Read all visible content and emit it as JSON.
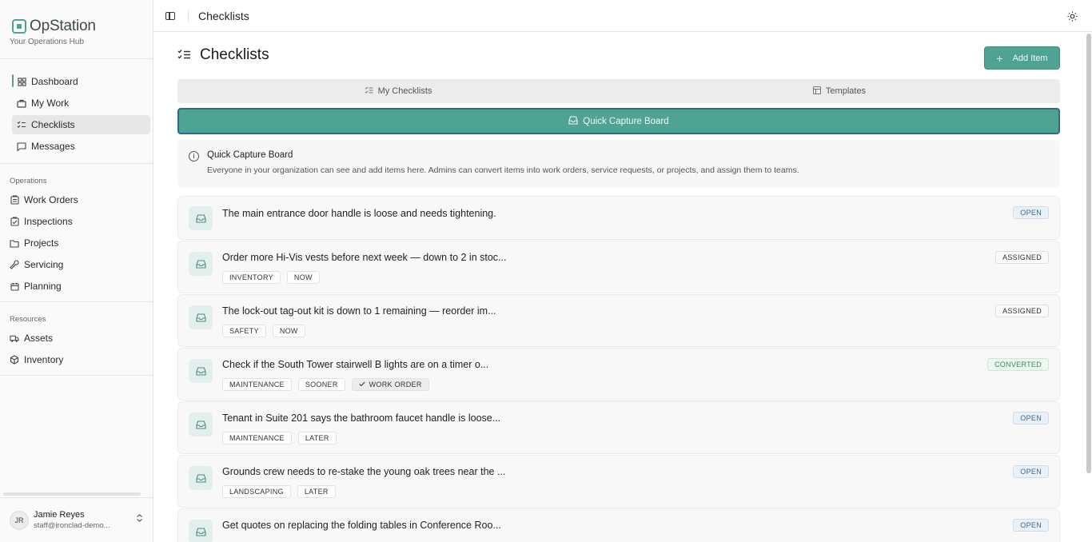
{
  "brand": {
    "name": "OpStation",
    "tagline": "Your Operations Hub"
  },
  "nav_top": [
    {
      "label": "Dashboard",
      "icon": "dashboard-icon"
    },
    {
      "label": "My Work",
      "icon": "briefcase-icon"
    },
    {
      "label": "Checklists",
      "icon": "checklist-icon"
    },
    {
      "label": "Messages",
      "icon": "message-icon"
    }
  ],
  "operations": {
    "label": "Operations",
    "items": [
      {
        "label": "Work Orders"
      },
      {
        "label": "Inspections"
      },
      {
        "label": "Projects"
      },
      {
        "label": "Servicing"
      },
      {
        "label": "Planning"
      }
    ]
  },
  "resources": {
    "label": "Resources",
    "items": [
      {
        "label": "Assets"
      },
      {
        "label": "Inventory"
      }
    ]
  },
  "user": {
    "initials": "JR",
    "name": "Jamie Reyes",
    "email": "staff@ironclad-demo..."
  },
  "topbar": {
    "title": "Checklists"
  },
  "page": {
    "title": "Checklists",
    "add_label": "Add Item"
  },
  "tabs": [
    {
      "label": "My Checklists"
    },
    {
      "label": "Templates"
    }
  ],
  "quick_capture": {
    "label": "Quick Capture Board"
  },
  "info": {
    "title": "Quick Capture Board",
    "description": "Everyone in your organization can see and add items here. Admins can convert items into work orders, service requests, or projects, and assign them to teams."
  },
  "items": [
    {
      "text": "The main entrance door handle is loose and needs tightening.",
      "status": "OPEN",
      "tags": []
    },
    {
      "text": "Order more Hi-Vis vests before next week — down to 2 in stoc...",
      "status": "ASSIGNED",
      "tags": [
        "INVENTORY",
        "NOW"
      ]
    },
    {
      "text": "The lock-out tag-out kit is down to 1 remaining — reorder im...",
      "status": "ASSIGNED",
      "tags": [
        "SAFETY",
        "NOW"
      ]
    },
    {
      "text": "Check if the South Tower stairwell B lights are on a timer o...",
      "status": "CONVERTED",
      "tags": [
        "MAINTENANCE",
        "SOONER",
        "WORK ORDER"
      ]
    },
    {
      "text": "Tenant in Suite 201 says the bathroom faucet handle is loose...",
      "status": "OPEN",
      "tags": [
        "MAINTENANCE",
        "LATER"
      ]
    },
    {
      "text": "Grounds crew needs to re-stake the young oak trees near the ...",
      "status": "OPEN",
      "tags": [
        "LANDSCAPING",
        "LATER"
      ]
    },
    {
      "text": "Get quotes on replacing the folding tables in Conference Roo...",
      "status": "OPEN",
      "tags": []
    }
  ],
  "colors": {
    "accent": "#4fa392",
    "accent_border": "#2f6b86"
  }
}
